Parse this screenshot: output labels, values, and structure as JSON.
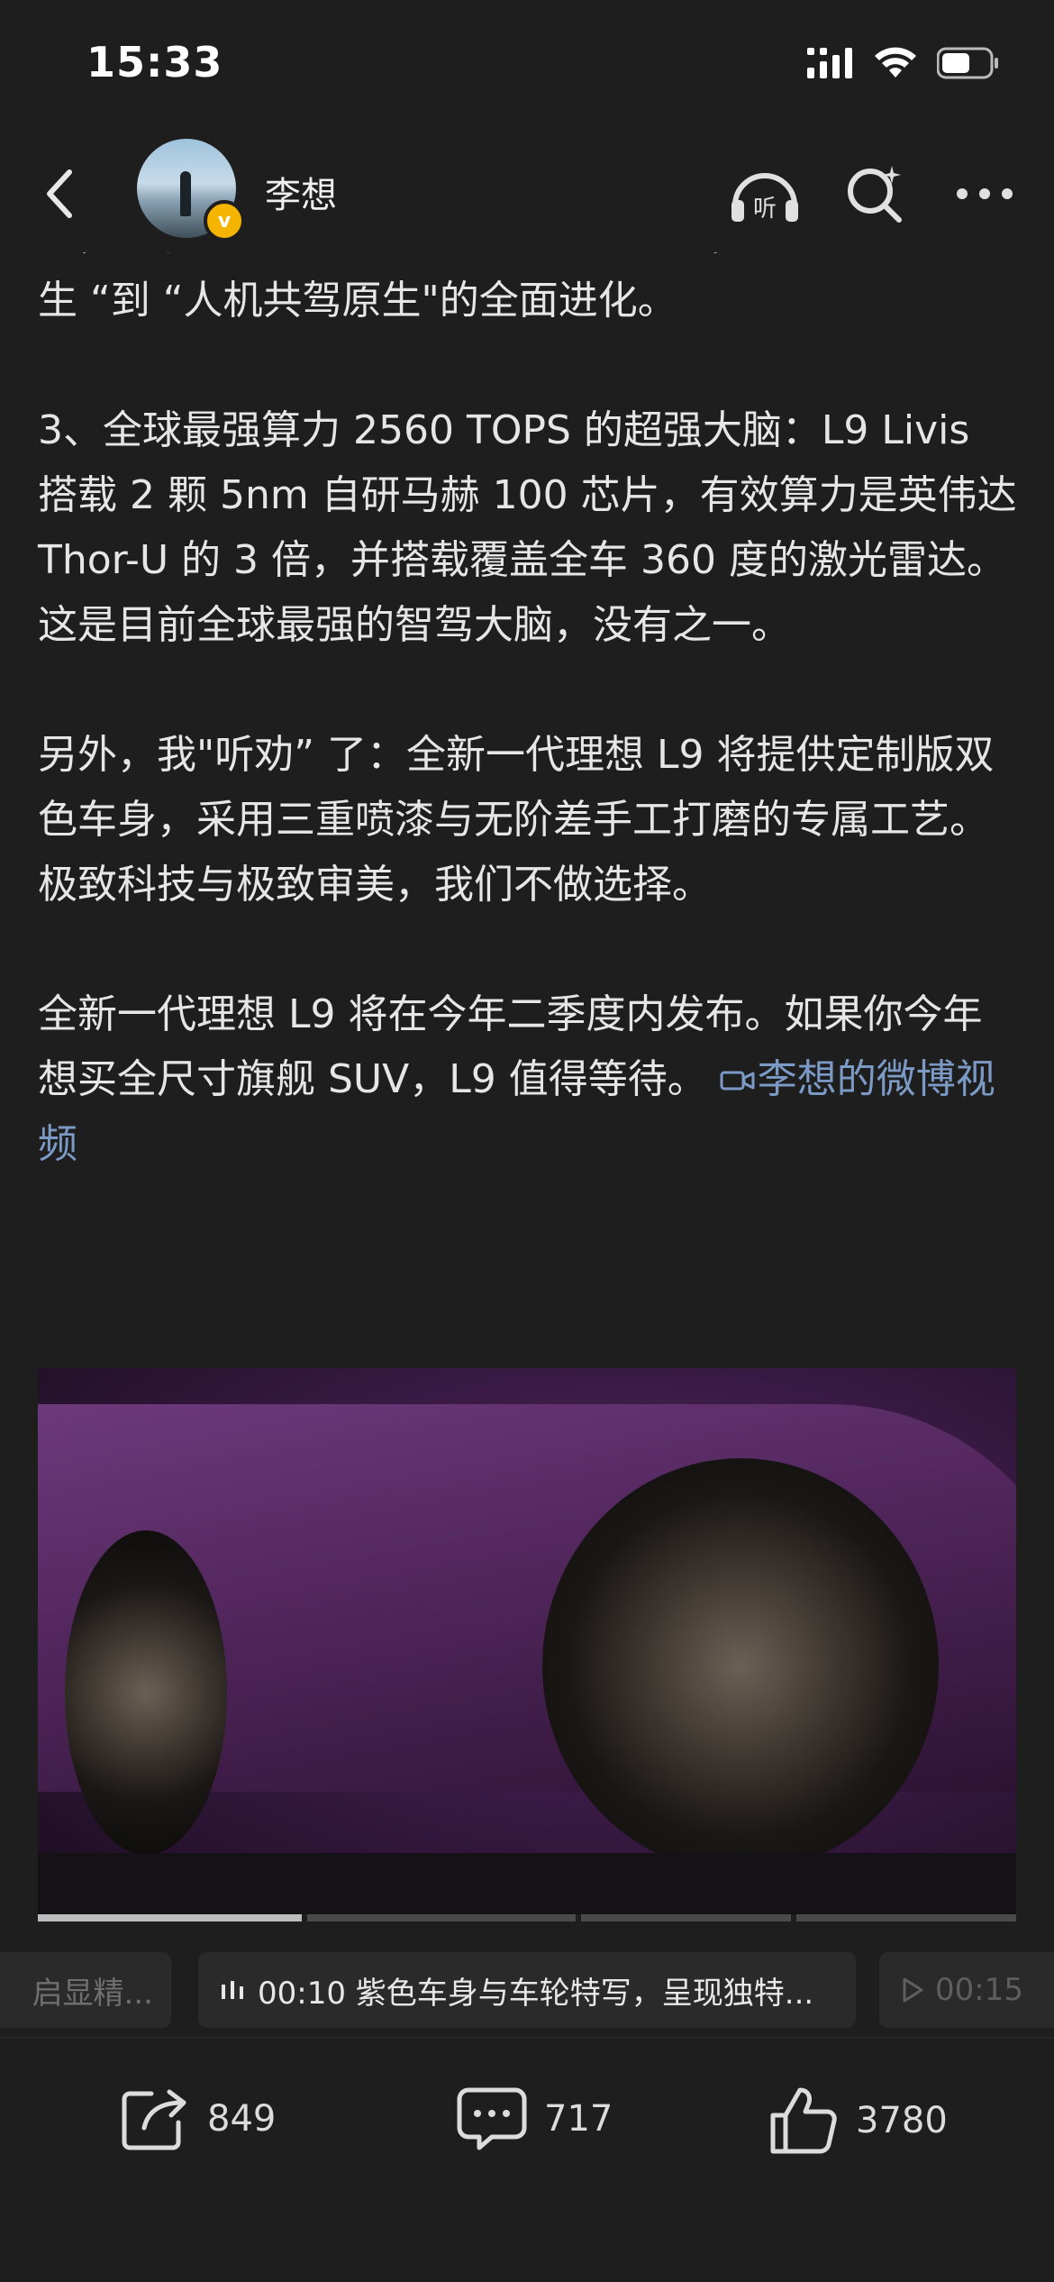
{
  "status_bar": {
    "time": "15:33"
  },
  "header": {
    "author_name": "李想",
    "verified_badge": "v"
  },
  "article": {
    "paragraphs": [
      "统，拥有如神经系统般的\"直觉级\"响应，完成从\"人驾原生 “到 “人机共驾原生\"的全面进化。",
      "3、全球最强算力 2560 TOPS 的超强大脑：L9 Livis 搭载 2 颗 5nm 自研马赫 100 芯片，有效算力是英伟达 Thor-U 的 3 倍，并搭载覆盖全车 360 度的激光雷达。这是目前全球最强的智驾大脑，没有之一。",
      "另外，我\"听劝” 了：全新一代理想 L9 将提供定制版双色车身，采用三重喷漆与无阶差手工打磨的专属工艺。极致科技与极致审美，我们不做选择。"
    ],
    "last_paragraph": "全新一代理想 L9 将在今年二季度内发布。如果你今年想买全尺寸旗舰 SUV，L9 值得等待。 ",
    "video_link": "李想的微博视频"
  },
  "video": {
    "progress": 0.27,
    "chapter_ticks": [
      0.27,
      0.55,
      0.77
    ]
  },
  "chapters": {
    "prev": "启显精...",
    "current": "00:10 紫色车身与车轮特写，呈现独特...",
    "next": "00:15"
  },
  "actions": {
    "share_count": "849",
    "comment_count": "717",
    "like_count": "3780"
  }
}
